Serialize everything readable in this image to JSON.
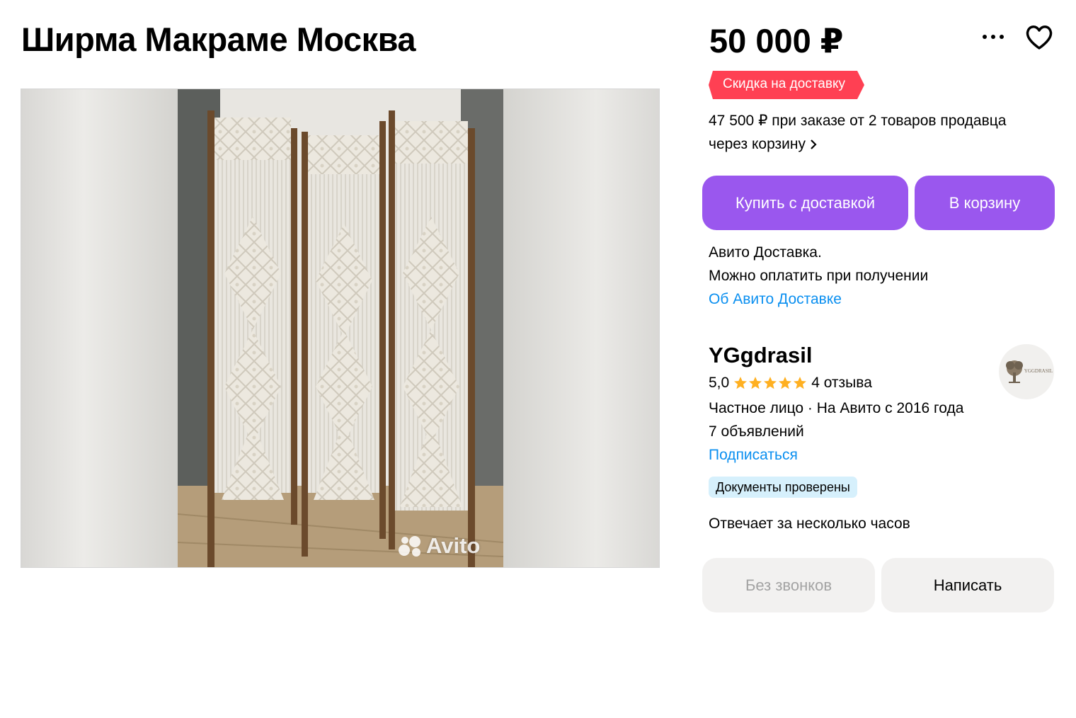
{
  "listing": {
    "title": "Ширма Макраме Москва",
    "price": "50 000 ₽",
    "discount_badge": "Скидка на доставку",
    "bulk_price_line1": "47 500 ₽ при заказе от 2 товаров продавца",
    "bulk_price_line2": "через корзину",
    "watermark": "Avito"
  },
  "actions": {
    "buy_with_delivery": "Купить с доставкой",
    "add_to_cart": "В корзину",
    "no_calls": "Без звонков",
    "write": "Написать"
  },
  "delivery": {
    "line1": "Авито Доставка.",
    "line2": "Можно оплатить при получении",
    "link": "Об Авито Доставке"
  },
  "seller": {
    "name": "YGgdrasil",
    "rating": "5,0",
    "stars": 5,
    "reviews": "4 отзыва",
    "info": "Частное лицо · На Авито с 2016 года",
    "ads_count": "7 объявлений",
    "subscribe": "Подписаться",
    "docs_badge": "Документы проверены",
    "response_time": "Отвечает за несколько часов",
    "avatar_text": "YGGDRASIL"
  },
  "colors": {
    "accent_purple": "#9a57ee",
    "discount_red": "#ff4053",
    "link_blue": "#0a8ff0",
    "star_orange": "#ffb021",
    "docs_badge_bg": "#d6f0fc"
  },
  "icons": [
    "more-icon",
    "heart-icon",
    "chevron-right-icon",
    "star-icon",
    "avito-logo-icon"
  ]
}
